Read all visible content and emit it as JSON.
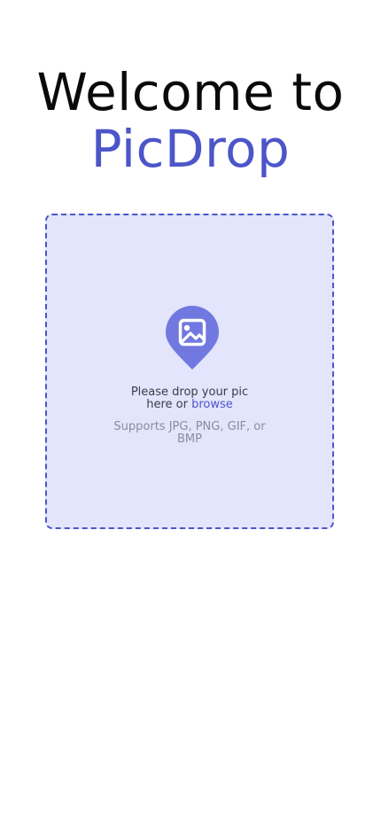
{
  "header": {
    "title_line1": "Welcome to",
    "title_brand": "PicDrop"
  },
  "dropzone": {
    "prompt_text": "Please drop your pic here or",
    "browse_label": "browse",
    "support_text": "Supports JPG, PNG, GIF, or BMP",
    "icon": "image-pin-icon"
  },
  "colors": {
    "accent": "#4c55c9",
    "dropzone_bg": "#e2e5fb",
    "pin_fill": "#7179e0",
    "title_text": "#0a0a0a",
    "muted_text": "#8a8ca2"
  }
}
